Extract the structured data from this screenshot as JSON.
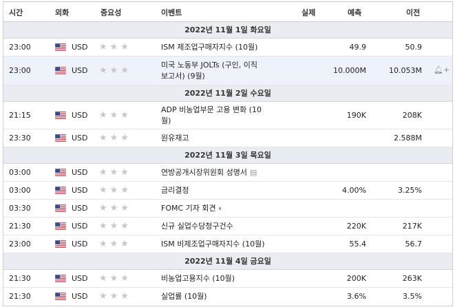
{
  "header": {
    "time": "시간",
    "currency": "외화",
    "importance": "중요성",
    "event": "이벤트",
    "actual": "실제",
    "forecast": "예측",
    "previous": "이전"
  },
  "star_glyphs": "★★★",
  "dates": [
    "2022년 11월 1일 화요일",
    "2022년 11월 2일 수요일",
    "2022년 11월 3일 목요일",
    "2022년 11월 4일 금요일"
  ],
  "rows": [
    {
      "time": "23:00",
      "currency": "USD",
      "event_lines": [
        "ISM 제조업구매자지수 (10월)"
      ],
      "forecast": "49.9",
      "previous": "50.9"
    },
    {
      "time": "23:00",
      "currency": "USD",
      "event_lines": [
        "미국 노동부 JOLTs (구인, 이직",
        "보고서) (9월)"
      ],
      "forecast": "10.000M",
      "previous": "10.053M"
    },
    {
      "time": "21:15",
      "currency": "USD",
      "event_lines": [
        "ADP 비농업부문 고용 변화 (10",
        "월)"
      ],
      "forecast": "190K",
      "previous": "208K"
    },
    {
      "time": "23:30",
      "currency": "USD",
      "event_lines": [
        "원유재고"
      ],
      "forecast": "",
      "previous": "2.588M"
    },
    {
      "time": "03:00",
      "currency": "USD",
      "event_lines": [
        "연방공개시장위원회 성명서"
      ],
      "forecast": "",
      "previous": ""
    },
    {
      "time": "03:00",
      "currency": "USD",
      "event_lines": [
        "금리결정"
      ],
      "forecast": "4.00%",
      "previous": "3.25%"
    },
    {
      "time": "03:30",
      "currency": "USD",
      "event_lines": [
        "FOMC 기자 회견"
      ],
      "forecast": "",
      "previous": ""
    },
    {
      "time": "21:30",
      "currency": "USD",
      "event_lines": [
        "신규 실업수당청구건수"
      ],
      "forecast": "220K",
      "previous": "217K"
    },
    {
      "time": "23:00",
      "currency": "USD",
      "event_lines": [
        "ISM 비제조업구매자지수 (10월)"
      ],
      "forecast": "55.4",
      "previous": "56.7"
    },
    {
      "time": "21:30",
      "currency": "USD",
      "event_lines": [
        "비농업고용지수 (10월)"
      ],
      "forecast": "200K",
      "previous": "263K"
    },
    {
      "time": "21:30",
      "currency": "USD",
      "event_lines": [
        "실업률 (10월)"
      ],
      "forecast": "3.6%",
      "previous": "3.5%"
    }
  ],
  "icons": {
    "flag": "us-flag-icon",
    "stars": "star-icon",
    "document": "document-icon",
    "speaker": "speaker-icon",
    "bell": "bell-plus-icon"
  },
  "colors": {
    "date_bg": "#e9ecf1",
    "highlight_bg": "#eef3fb",
    "star": "#c7c7c7",
    "border": "#c9ced6"
  }
}
